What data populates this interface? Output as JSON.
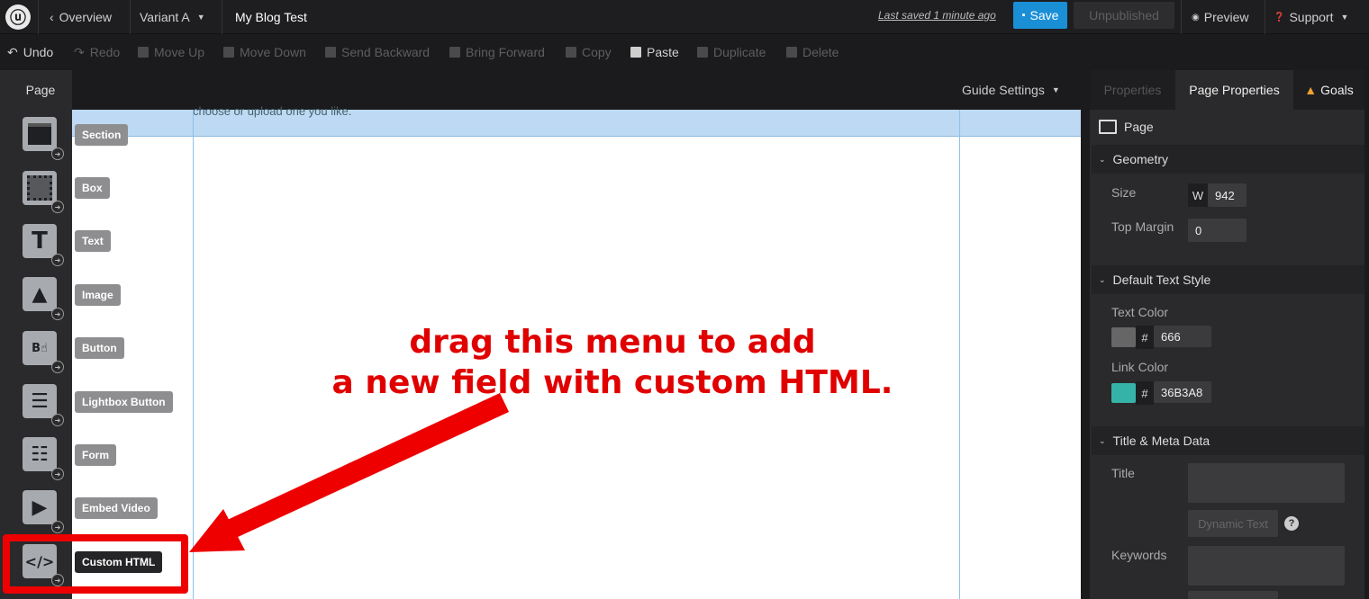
{
  "topbar": {
    "logo": "ⓤ",
    "overview": "Overview",
    "variant": "Variant A",
    "page_title": "My Blog Test",
    "last_saved": "Last saved  1 minute ago",
    "save": "Save",
    "unpublished": "Unpublished",
    "preview": "Preview",
    "support": "Support"
  },
  "toolbar": {
    "undo": "Undo",
    "redo": "Redo",
    "move_up": "Move Up",
    "move_down": "Move Down",
    "send_backward": "Send Backward",
    "bring_forward": "Bring Forward",
    "copy": "Copy",
    "paste": "Paste",
    "duplicate": "Duplicate",
    "delete": "Delete"
  },
  "sidebar": {
    "heading": "Page",
    "items": [
      {
        "label": "Section",
        "icon": "section-icon"
      },
      {
        "label": "Box",
        "icon": "box-icon"
      },
      {
        "label": "Text",
        "icon": "text-icon"
      },
      {
        "label": "Image",
        "icon": "image-icon"
      },
      {
        "label": "Button",
        "icon": "button-icon"
      },
      {
        "label": "Lightbox Button",
        "icon": "lightbox-icon"
      },
      {
        "label": "Form",
        "icon": "form-icon"
      },
      {
        "label": "Embed Video",
        "icon": "video-icon"
      },
      {
        "label": "Custom HTML",
        "icon": "code-icon"
      }
    ]
  },
  "canvas": {
    "guide_settings": "Guide Settings",
    "band_text": "choose or upload one you like."
  },
  "annotation": {
    "line1": "drag this menu to add",
    "line2": "a new field with custom HTML."
  },
  "right_panel": {
    "tabs": {
      "properties": "Properties",
      "page_properties": "Page Properties",
      "goals": "Goals"
    },
    "page_label": "Page",
    "geometry": {
      "title": "Geometry",
      "size_label": "Size",
      "size_prefix": "W",
      "size_value": "942",
      "top_margin_label": "Top Margin",
      "top_margin_value": "0"
    },
    "text_style": {
      "title": "Default Text Style",
      "text_color_label": "Text Color",
      "text_color_value": "666",
      "link_color_label": "Link Color",
      "link_color_value": "36B3A8",
      "hash": "#"
    },
    "meta": {
      "title": "Title & Meta Data",
      "title_label": "Title",
      "dynamic_text": "Dynamic Text",
      "keywords_label": "Keywords",
      "help": "?"
    }
  },
  "colors": {
    "accent": "#1a8fd6",
    "annotation": "#e00000",
    "link_color": "#36B3A8",
    "text_color": "#666666"
  }
}
